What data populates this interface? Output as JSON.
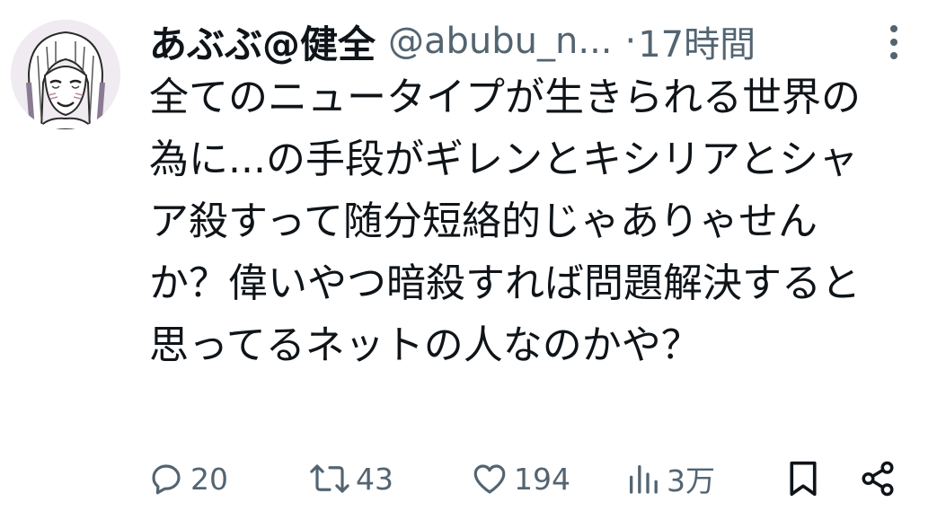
{
  "author": {
    "display_name": "あぶぶ@健全",
    "handle": "@abubu_n...",
    "separator": "·",
    "time": "17時間"
  },
  "tweet": {
    "text": "全てのニュータイプが生きられる世界の為に...の手段がギレンとキシリアとシャア殺すって随分短絡的じゃありゃせんか？偉いやつ暗殺すれば問題解決すると思ってるネットの人なのかや？"
  },
  "actions": {
    "reply_count": "20",
    "retweet_count": "43",
    "like_count": "194",
    "view_count": "3万"
  },
  "icons": {
    "more": "more-vertical-icon",
    "reply": "reply-icon",
    "retweet": "retweet-icon",
    "like": "heart-icon",
    "views": "views-icon",
    "bookmark": "bookmark-icon",
    "share": "share-icon"
  },
  "colors": {
    "text_primary": "#0f1419",
    "text_secondary": "#536471",
    "background": "#ffffff"
  }
}
